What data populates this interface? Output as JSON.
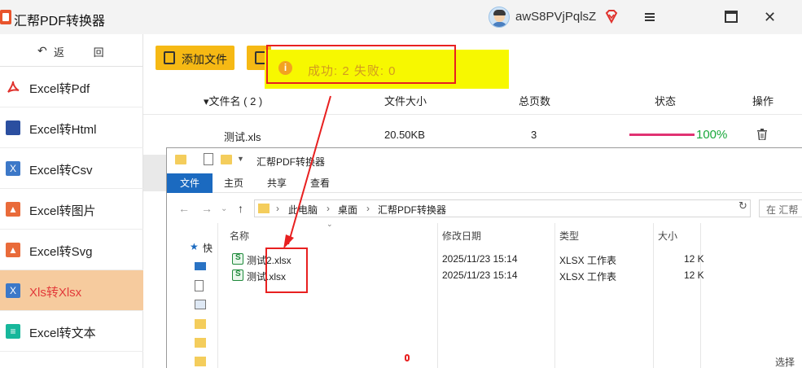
{
  "app": {
    "title": "汇帮PDF转换器",
    "username": "awS8PVjPqlsZ"
  },
  "sidebar": {
    "back_label": "返 回",
    "items": [
      {
        "label": "Excel转Pdf",
        "icon": "pdf-icon",
        "color": "#e0332e"
      },
      {
        "label": "Excel转Html",
        "icon": "html-icon",
        "color": "#2b4fa0"
      },
      {
        "label": "Excel转Csv",
        "icon": "excel-icon",
        "color": "#3c78c8"
      },
      {
        "label": "Excel转图片",
        "icon": "image-icon",
        "color": "#e96b3a"
      },
      {
        "label": "Excel转Svg",
        "icon": "svg-icon",
        "color": "#e96b3a"
      },
      {
        "label": "Xls转Xlsx",
        "icon": "excel-icon",
        "color": "#3c78c8",
        "active": true
      },
      {
        "label": "Excel转文本",
        "icon": "text-icon",
        "color": "#17b79b"
      }
    ]
  },
  "toolbar": {
    "add_file_label": "添加文件"
  },
  "toast": {
    "text": "成功: 2   失败: 0",
    "color": "#f7f800"
  },
  "table": {
    "headers": [
      "▾文件名 ( 2 )",
      "文件大小",
      "总页数",
      "状态",
      "操作"
    ],
    "row": {
      "name": "测试.xls",
      "size": "20.50KB",
      "pages": "3",
      "progress": 1.0,
      "progress_label": "100%"
    }
  },
  "explorer": {
    "title": "汇帮PDF转换器",
    "ribbon_tabs": [
      "文件",
      "主页",
      "共享",
      "查看"
    ],
    "breadcrumbs": [
      "此电脑",
      "桌面",
      "汇帮PDF转换器"
    ],
    "search_placeholder": "在 汇帮",
    "quick_access_label": "快",
    "columns": [
      "名称",
      "修改日期",
      "类型",
      "大小"
    ],
    "files": [
      {
        "name": "测试2.xlsx",
        "date": "2025/11/23 15:14",
        "type": "XLSX 工作表",
        "size": "12 K"
      },
      {
        "name": "测试.xlsx",
        "date": "2025/11/23 15:14",
        "type": "XLSX 工作表",
        "size": "12 K"
      }
    ],
    "status_text": "选择要"
  },
  "colors": {
    "accent": "#f6b914",
    "active_nav": "#f6cb9e",
    "highlight_red": "#e82020",
    "progress": "#e03272",
    "success_green": "#18a83a"
  }
}
